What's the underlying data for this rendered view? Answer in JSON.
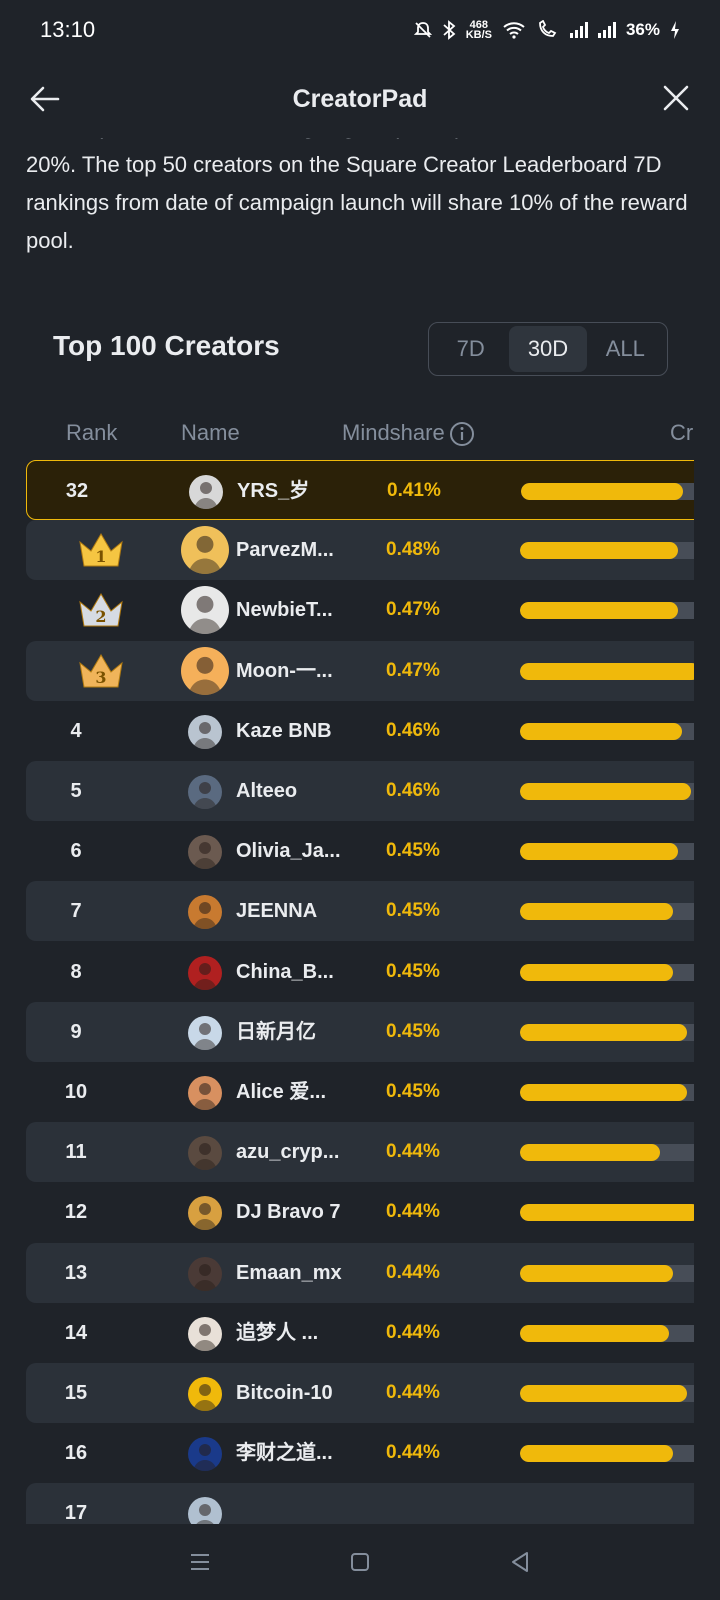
{
  "status": {
    "time": "13:10",
    "net_speed_top": "468",
    "net_speed_bottom": "KB/S",
    "battery": "36%"
  },
  "header": {
    "title": "CreatorPad"
  },
  "intro": {
    "cut_line": "reward pool and all remaining eligible participants will share",
    "text": "20%. The top 50 creators on the Square Creator Leaderboard 7D rankings from date of campaign launch will share 10% of the reward pool."
  },
  "leaderboard": {
    "title": "Top 100 Creators",
    "tabs": [
      {
        "label": "7D",
        "active": false
      },
      {
        "label": "30D",
        "active": true
      },
      {
        "label": "ALL",
        "active": false
      }
    ],
    "columns": {
      "rank": "Rank",
      "name": "Name",
      "mindshare": "Mindshare",
      "extra": "Cr"
    },
    "current_user": {
      "rank": "32",
      "name": "YRS_岁",
      "mindshare": "0.41%",
      "bar": 0.9
    },
    "rows": [
      {
        "rank": "1",
        "crown": "gold",
        "name": "ParvezM...",
        "mindshare": "0.48%",
        "bar": 0.88,
        "avatar_color": "#f0c05a"
      },
      {
        "rank": "2",
        "crown": "silver",
        "name": "NewbieT...",
        "mindshare": "0.47%",
        "bar": 0.88,
        "avatar_color": "#e8e8e8"
      },
      {
        "rank": "3",
        "crown": "bronze",
        "name": "Moon-一...",
        "mindshare": "0.47%",
        "bar": 1.0,
        "avatar_color": "#f5b05a"
      },
      {
        "rank": "4",
        "name": "Kaze BNB",
        "mindshare": "0.46%",
        "bar": 0.9,
        "avatar_color": "#b9c4d0"
      },
      {
        "rank": "5",
        "name": "Alteeo",
        "mindshare": "0.46%",
        "bar": 0.95,
        "avatar_color": "#5a6a80"
      },
      {
        "rank": "6",
        "name": "Olivia_Ja...",
        "mindshare": "0.45%",
        "bar": 0.88,
        "avatar_color": "#6b5a50"
      },
      {
        "rank": "7",
        "name": "JEENNA",
        "mindshare": "0.45%",
        "bar": 0.85,
        "avatar_color": "#c87a30"
      },
      {
        "rank": "8",
        "name": "China_B...",
        "mindshare": "0.45%",
        "bar": 0.85,
        "avatar_color": "#b02020"
      },
      {
        "rank": "9",
        "name": "日新月亿",
        "mindshare": "0.45%",
        "bar": 0.93,
        "avatar_color": "#c8d8e8"
      },
      {
        "rank": "10",
        "name": "Alice 爱...",
        "mindshare": "0.45%",
        "bar": 0.93,
        "avatar_color": "#d89060"
      },
      {
        "rank": "11",
        "name": "azu_cryp...",
        "mindshare": "0.44%",
        "bar": 0.78,
        "avatar_color": "#5a4a40"
      },
      {
        "rank": "12",
        "name": "DJ Bravo 7",
        "mindshare": "0.44%",
        "bar": 1.0,
        "avatar_color": "#d8a040"
      },
      {
        "rank": "13",
        "name": "Emaan_mx",
        "mindshare": "0.44%",
        "bar": 0.85,
        "avatar_color": "#4a3a36"
      },
      {
        "rank": "14",
        "name": "追梦人 ...",
        "mindshare": "0.44%",
        "bar": 0.83,
        "avatar_color": "#e8e0d8"
      },
      {
        "rank": "15",
        "name": "Bitcoin-10",
        "mindshare": "0.44%",
        "bar": 0.93,
        "avatar_color": "#f0b90b"
      },
      {
        "rank": "16",
        "name": "李财之道...",
        "mindshare": "0.44%",
        "bar": 0.85,
        "avatar_color": "#1a3a8a"
      },
      {
        "rank": "17",
        "name": "",
        "mindshare": "",
        "bar": 0,
        "avatar_color": "#b0c0d0"
      }
    ]
  },
  "colors": {
    "accent": "#f0b90b",
    "bg": "#1f2329",
    "row_alt": "#2b3139",
    "gold": "#f5c542",
    "silver": "#d6dbe3",
    "bronze": "#f0b45a"
  }
}
